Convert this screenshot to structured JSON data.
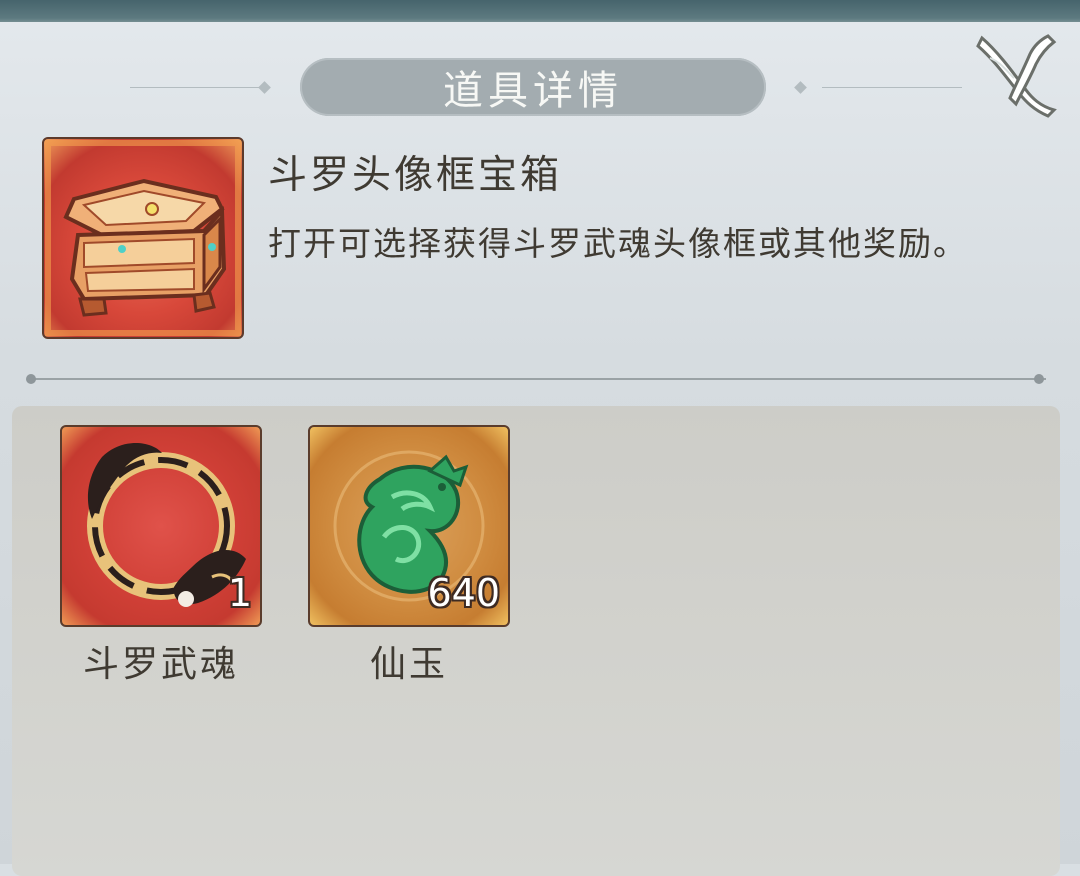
{
  "dialog": {
    "title": "道具详情",
    "close_icon": "close-x-icon"
  },
  "item": {
    "name": "斗罗头像框宝箱",
    "description": "打开可选择获得斗罗武魂头像框或其他奖励。",
    "icon": "treasure-chest-icon",
    "rarity_color": "#d8483a"
  },
  "rewards": [
    {
      "label": "斗罗武魂",
      "count": "1",
      "icon": "dragon-ring-frame-icon",
      "frame_color": "#cf3f36"
    },
    {
      "label": "仙玉",
      "count": "640",
      "icon": "jade-dragon-icon",
      "frame_color": "#cf8b3f"
    }
  ]
}
